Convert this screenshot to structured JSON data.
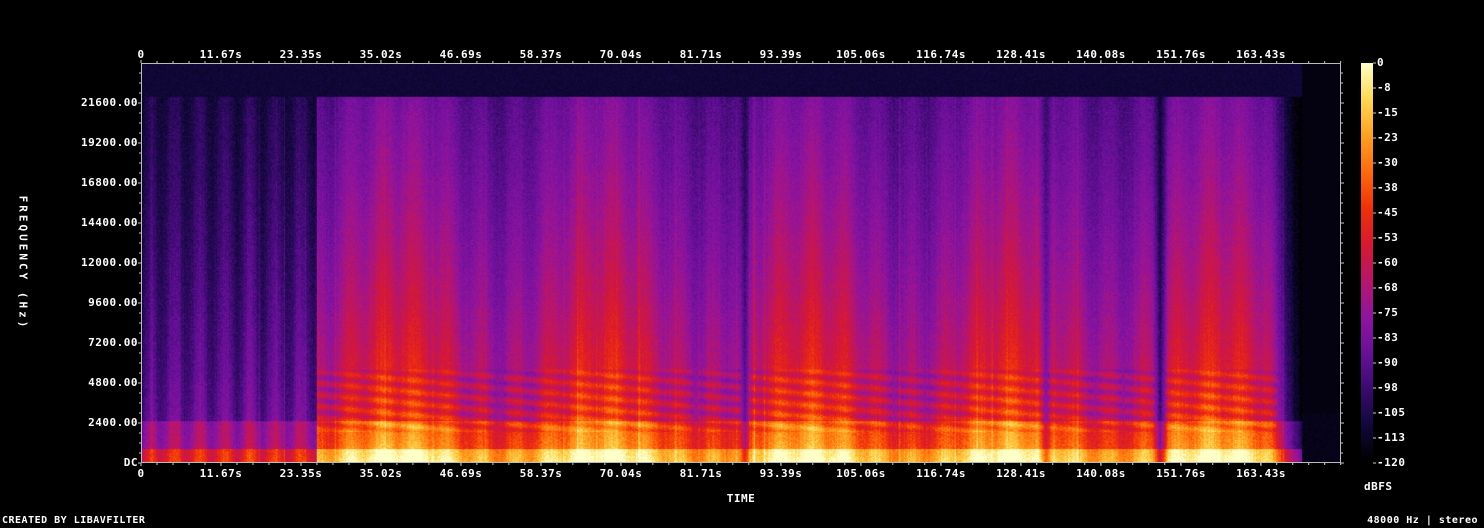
{
  "chart_data": {
    "type": "heatmap",
    "title": "",
    "xlabel": "TIME",
    "ylabel": "FREQUENCY (Hz)",
    "x_ticks": [
      "0",
      "11.67s",
      "23.35s",
      "35.02s",
      "46.69s",
      "58.37s",
      "70.04s",
      "81.71s",
      "93.39s",
      "105.06s",
      "116.74s",
      "128.41s",
      "140.08s",
      "151.76s",
      "163.43s"
    ],
    "x_tick_values": [
      0,
      11.67,
      23.35,
      35.02,
      46.69,
      58.37,
      70.04,
      81.71,
      93.39,
      105.06,
      116.74,
      128.41,
      140.08,
      151.76,
      163.43
    ],
    "xlim": [
      0,
      175.1
    ],
    "y_ticks": [
      "DC",
      "2400.00",
      "4800.00",
      "7200.00",
      "9600.00",
      "12000.00",
      "14400.00",
      "16800.00",
      "19200.00",
      "21600.00"
    ],
    "y_tick_values": [
      0,
      2400,
      4800,
      7200,
      9600,
      12000,
      14400,
      16800,
      19200,
      21600
    ],
    "ylim": [
      0,
      24000
    ],
    "colorbar_label": "dBFS",
    "colorbar_ticks": [
      "0",
      "-8",
      "-15",
      "-23",
      "-30",
      "-38",
      "-45",
      "-53",
      "-60",
      "-68",
      "-75",
      "-83",
      "-90",
      "-98",
      "-105",
      "-113",
      "-120"
    ],
    "colorbar_range": [
      -120,
      0
    ],
    "content_cutoff_hz": 22050,
    "audio_end_s": 168.5,
    "quiet_intro_end_s": 25.5,
    "dropout_times_s": [
      88.1,
      132.0,
      148.8
    ],
    "colormap": [
      "#000000",
      "#10083a",
      "#3a0a6e",
      "#68109a",
      "#8e14a0",
      "#b8156e",
      "#d81830",
      "#f0300a",
      "#ff6a0a",
      "#ffa020",
      "#ffd850",
      "#ffffc8"
    ]
  },
  "footer": {
    "left": "CREATED BY LIBAVFILTER",
    "right": "48000 Hz | stereo"
  }
}
